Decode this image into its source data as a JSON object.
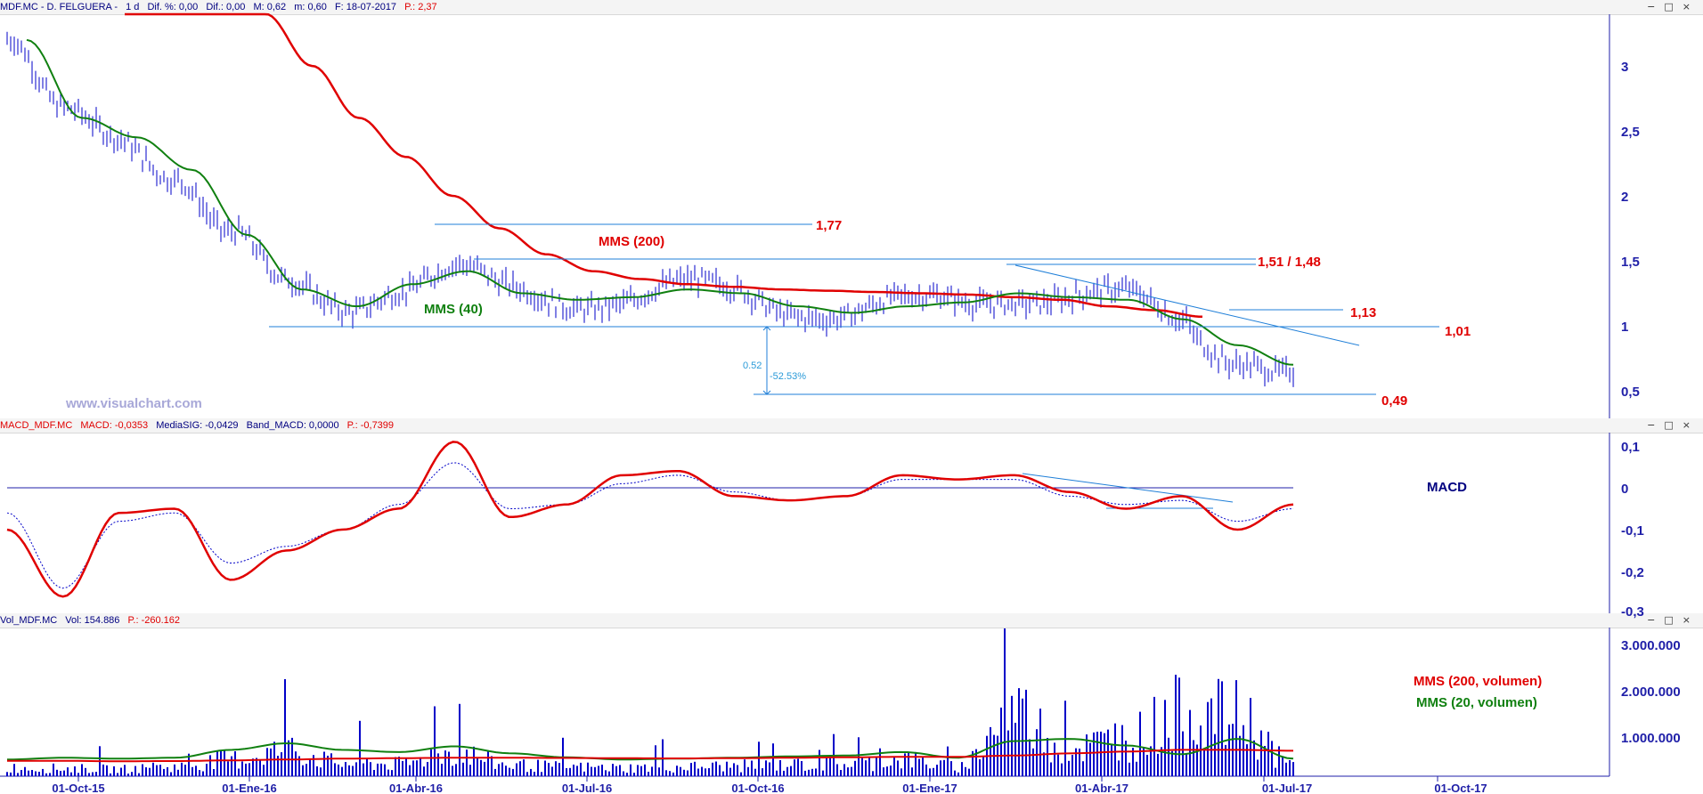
{
  "colors": {
    "price_bars": "#0000c8",
    "mms40": "#108010",
    "mms200": "#e00000",
    "macd": "#e00000",
    "signal": "#0000c8",
    "volume": "#0000c8",
    "trendline": "#1f7fd8",
    "axis": "#1f1fa8"
  },
  "header_price": {
    "ticker": "MDF.MC - D. FELGUERA -",
    "period": "1 d",
    "dif_pct": "Dif. %: 0,00",
    "dif": "Dif.: 0,00",
    "max": "M: 0,62",
    "min": "m: 0,60",
    "date": "F: 18-07-2017",
    "p": "P.: 2,37"
  },
  "header_macd": {
    "name": "MACD_MDF.MC",
    "macd": "MACD: -0,0353",
    "signal": "MediaSIG: -0,0429",
    "band": "Band_MACD: 0,0000",
    "p": "P.: -0,7399"
  },
  "header_vol": {
    "name": "Vol_MDF.MC",
    "vol": "Vol: 154.886",
    "p": "P.: -260.162"
  },
  "window_buttons": [
    "−",
    "□",
    "×"
  ],
  "watermark": "www.visualchart.com",
  "annotations": {
    "mms200": "MMS (200)",
    "mms40": "MMS (40)",
    "l177": "1,77",
    "l151": "1,51 / 1,48",
    "l113": "1,13",
    "l101": "1,01",
    "l049": "0,49",
    "diff_abs": "0.52",
    "diff_pct": "-52.53%",
    "macd_label": "MACD",
    "vol_mms200": "MMS (200, volumen)",
    "vol_mms20": "MMS (20, volumen)"
  },
  "price_axis": [
    "3",
    "2,5",
    "2",
    "1,5",
    "1",
    "0,5"
  ],
  "macd_axis": [
    "0,1",
    "0",
    "-0,1",
    "-0,2",
    "-0,3"
  ],
  "vol_axis": [
    "3.000.000",
    "2.000.000",
    "1.000.000"
  ],
  "x_labels": [
    "01-Oct-15",
    "01-Ene-16",
    "01-Abr-16",
    "01-Jul-16",
    "01-Oct-16",
    "01-Ene-17",
    "01-Abr-17",
    "01-Jul-17",
    "01-Oct-17"
  ],
  "chart_data": [
    {
      "type": "line",
      "panel": "price",
      "x": [
        "2015-08",
        "2015-09",
        "2015-10",
        "2015-11",
        "2015-12",
        "2016-01",
        "2016-02",
        "2016-03",
        "2016-04",
        "2016-05",
        "2016-06",
        "2016-07",
        "2016-08",
        "2016-09",
        "2016-10",
        "2016-11",
        "2016-12",
        "2017-01",
        "2017-02",
        "2017-03",
        "2017-04",
        "2017-05",
        "2017-06",
        "2017-07"
      ],
      "series": [
        {
          "name": "MMS (40)",
          "values": [
            3.2,
            2.6,
            2.45,
            2.2,
            1.7,
            1.28,
            1.15,
            1.32,
            1.42,
            1.25,
            1.2,
            1.22,
            1.28,
            1.25,
            1.15,
            1.1,
            1.15,
            1.18,
            1.25,
            1.22,
            1.2,
            1.05,
            0.85,
            0.7
          ]
        },
        {
          "name": "MMS (200)",
          "values": [
            4.1,
            3.9,
            3.7,
            3.4,
            3.0,
            2.6,
            2.3,
            2.0,
            1.75,
            1.55,
            1.42,
            1.36,
            1.32,
            1.3,
            1.28,
            1.27,
            1.26,
            1.25,
            1.24,
            1.22,
            1.2,
            1.15,
            1.12,
            1.07
          ]
        }
      ],
      "ylim": [
        0.3,
        3.4
      ],
      "levels": [
        1.77,
        1.51,
        1.48,
        1.13,
        1.01,
        0.49
      ]
    },
    {
      "type": "line",
      "panel": "macd",
      "x": [
        "2015-08",
        "2015-09",
        "2015-10",
        "2015-11",
        "2015-12",
        "2016-01",
        "2016-02",
        "2016-03",
        "2016-04",
        "2016-05",
        "2016-06",
        "2016-07",
        "2016-08",
        "2016-09",
        "2016-10",
        "2016-11",
        "2016-12",
        "2017-01",
        "2017-02",
        "2017-03",
        "2017-04",
        "2017-05",
        "2017-06",
        "2017-07"
      ],
      "series": [
        {
          "name": "MACD",
          "values": [
            -0.1,
            -0.26,
            -0.06,
            -0.05,
            -0.22,
            -0.15,
            -0.1,
            -0.05,
            0.11,
            -0.07,
            -0.04,
            0.03,
            0.04,
            -0.02,
            -0.03,
            -0.02,
            0.03,
            0.02,
            0.03,
            -0.01,
            -0.05,
            -0.02,
            -0.1,
            -0.04
          ]
        },
        {
          "name": "MediaSIG",
          "values": [
            -0.06,
            -0.24,
            -0.08,
            -0.06,
            -0.18,
            -0.14,
            -0.1,
            -0.04,
            0.06,
            -0.05,
            -0.04,
            0.01,
            0.03,
            -0.01,
            -0.03,
            -0.02,
            0.02,
            0.02,
            0.02,
            -0.02,
            -0.04,
            -0.03,
            -0.08,
            -0.05
          ]
        }
      ],
      "ylim": [
        -0.3,
        0.12
      ]
    },
    {
      "type": "bar",
      "panel": "volume",
      "x": [
        "2015-08",
        "2015-09",
        "2015-10",
        "2015-11",
        "2015-12",
        "2016-01",
        "2016-02",
        "2016-03",
        "2016-04",
        "2016-05",
        "2016-06",
        "2016-07",
        "2016-08",
        "2016-09",
        "2016-10",
        "2016-11",
        "2016-12",
        "2017-01",
        "2017-02",
        "2017-03",
        "2017-04",
        "2017-05",
        "2017-06",
        "2017-07"
      ],
      "series": [
        {
          "name": "Vol",
          "values": [
            450000,
            420000,
            380000,
            500000,
            900000,
            1400000,
            700000,
            650000,
            1300000,
            600000,
            500000,
            450000,
            500000,
            550000,
            600000,
            650000,
            900000,
            500000,
            3400000,
            1500000,
            2000000,
            3400000,
            3200000,
            600000
          ]
        },
        {
          "name": "MMS (200, volumen)",
          "values": [
            350000,
            350000,
            340000,
            345000,
            360000,
            380000,
            400000,
            410000,
            420000,
            420000,
            415000,
            410000,
            405000,
            410000,
            420000,
            430000,
            440000,
            440000,
            470000,
            520000,
            560000,
            600000,
            600000,
            580000
          ]
        },
        {
          "name": "MMS (20, volumen)",
          "values": [
            380000,
            420000,
            400000,
            420000,
            600000,
            750000,
            600000,
            550000,
            680000,
            520000,
            430000,
            380000,
            400000,
            420000,
            450000,
            470000,
            550000,
            420000,
            800000,
            850000,
            700000,
            500000,
            850000,
            400000
          ]
        }
      ],
      "ylim": [
        0,
        3500000
      ]
    }
  ]
}
